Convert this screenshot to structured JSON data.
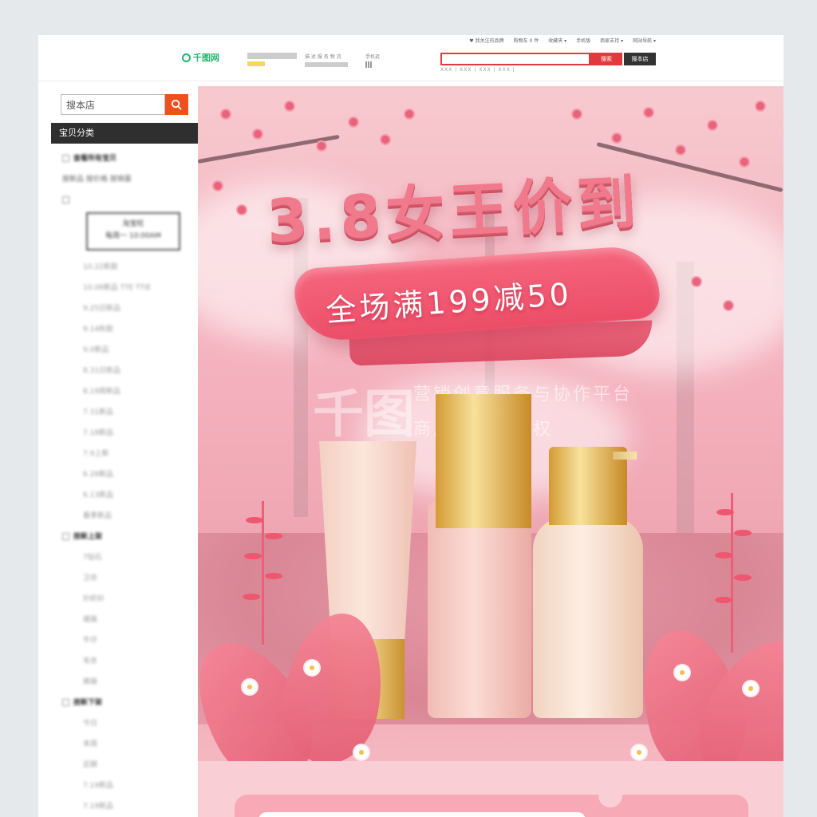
{
  "topbar": {
    "utility_links": [
      "♥ 我关注的品牌",
      "购物车 0 件",
      "收藏夹 ▾",
      "手机版",
      "商家支持 ▾",
      "网站导航 ▾"
    ],
    "logo_text": "千图网",
    "rating_label": "描 述 服 务 物 流",
    "phone_label": "手机逛",
    "search_placeholder": "",
    "search_button": "搜索",
    "shop_search_button": "搜本店",
    "hot_links": "XXX | XXX | XXX | XXX |"
  },
  "sidebar": {
    "search_placeholder": "搜本店",
    "category_header": "宝贝分类",
    "groups": [
      {
        "label": "查看所有宝贝"
      },
      {
        "label": "按新品 按价格 按销量"
      }
    ],
    "card_line1": "淘宝旺",
    "card_line2": "每周一 10:00AM",
    "items_a": [
      "10.22新款",
      "10.08新品 TTE TTIE",
      "9.25日新品",
      "9.14秋款",
      "9.0新品",
      "8.31日新品",
      "8.19周新品",
      "7.31新品",
      "7.18新品",
      "7.9上新",
      "6.28新品",
      "6.13新品",
      "春季新品"
    ],
    "group_b": "按新上架",
    "items_b": [
      "7钻石",
      "卫衣",
      "针织衫",
      "裙装",
      "牛仔",
      "毛衣",
      "裤装"
    ],
    "group_c": "按新下架",
    "items_c": [
      "今日",
      "本周",
      "近期",
      "7.19新品",
      "7.19新品"
    ]
  },
  "banner": {
    "headline": "3.8女王价到",
    "ribbon_text": "全场满199减50",
    "watermark_logo": "千图",
    "watermark_line1": "营销创意服务与协作平台",
    "watermark_line2": "商用请获取授权"
  },
  "colors": {
    "accent_red": "#e4393c",
    "side_search": "#f0501e",
    "brand_green": "#21b36b",
    "banner_pink": "#f5b3bf"
  }
}
